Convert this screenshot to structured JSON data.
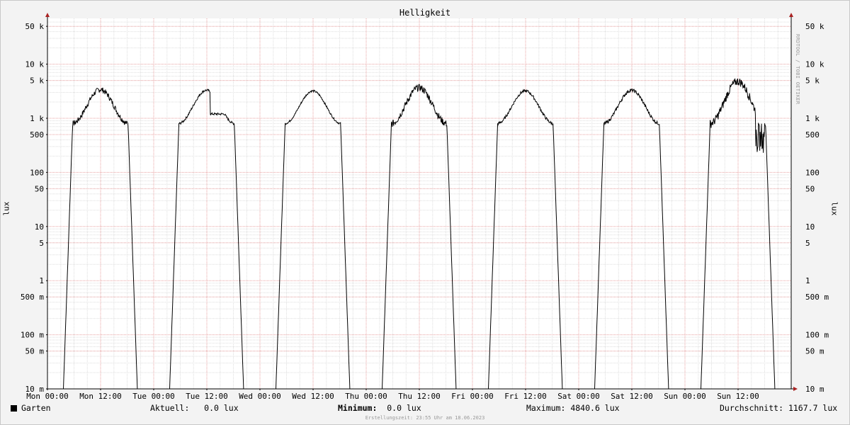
{
  "chart_data": {
    "type": "line",
    "title": "Helligkeit",
    "ylabel": "lux",
    "yscale": "log",
    "ylim": [
      0.01,
      70000
    ],
    "xlim": [
      0,
      168
    ],
    "grid": true,
    "y_ticks": [
      {
        "v": 0.01,
        "label": "10 m"
      },
      {
        "v": 0.05,
        "label": "50 m"
      },
      {
        "v": 0.1,
        "label": "100 m"
      },
      {
        "v": 0.5,
        "label": "500 m"
      },
      {
        "v": 1,
        "label": "1"
      },
      {
        "v": 5,
        "label": "5"
      },
      {
        "v": 10,
        "label": "10"
      },
      {
        "v": 50,
        "label": "50"
      },
      {
        "v": 100,
        "label": "100"
      },
      {
        "v": 500,
        "label": "500"
      },
      {
        "v": 1000,
        "label": "1 k"
      },
      {
        "v": 5000,
        "label": "5 k"
      },
      {
        "v": 10000,
        "label": "10 k"
      },
      {
        "v": 50000,
        "label": "50 k"
      }
    ],
    "x_ticks": [
      {
        "h": 0,
        "label": "Mon 00:00"
      },
      {
        "h": 12,
        "label": "Mon 12:00"
      },
      {
        "h": 24,
        "label": "Tue 00:00"
      },
      {
        "h": 36,
        "label": "Tue 12:00"
      },
      {
        "h": 48,
        "label": "Wed 00:00"
      },
      {
        "h": 60,
        "label": "Wed 12:00"
      },
      {
        "h": 72,
        "label": "Thu 00:00"
      },
      {
        "h": 84,
        "label": "Thu 12:00"
      },
      {
        "h": 96,
        "label": "Fri 00:00"
      },
      {
        "h": 108,
        "label": "Fri 12:00"
      },
      {
        "h": 120,
        "label": "Sat 00:00"
      },
      {
        "h": 132,
        "label": "Sat 12:00"
      },
      {
        "h": 144,
        "label": "Sun 00:00"
      },
      {
        "h": 156,
        "label": "Sun 12:00"
      }
    ],
    "series": [
      {
        "name": "Garten",
        "color": "#000000",
        "days": [
          {
            "day_start_h": 0,
            "peak_lux": 3400,
            "noise": 0.12
          },
          {
            "day_start_h": 24,
            "peak_lux": 3300,
            "noise": 0.05,
            "evening_plateau_lux": 1200
          },
          {
            "day_start_h": 48,
            "peak_lux": 3200,
            "noise": 0.04
          },
          {
            "day_start_h": 72,
            "peak_lux": 3700,
            "noise": 0.15
          },
          {
            "day_start_h": 96,
            "peak_lux": 3200,
            "noise": 0.06
          },
          {
            "day_start_h": 120,
            "peak_lux": 3300,
            "noise": 0.07
          },
          {
            "day_start_h": 144,
            "peak_lux": 4840.6,
            "noise": 0.18,
            "afternoon_dip_lux": 300
          }
        ],
        "sunrise_h": 3.6,
        "sunset_h": 20.3
      }
    ]
  },
  "legend": {
    "series_name": "Garten",
    "current_label": "Aktuell:",
    "current_value": "0.0 lux",
    "min_label": "Minimum:",
    "min_value": "0.0 lux",
    "max_label": "Maximum:",
    "max_value": "4840.6 lux",
    "avg_label": "Durchschnitt:",
    "avg_value": "1167.7 lux"
  },
  "footer": "Erstellungszeit: 23:55 Uhr am 18.06.2023",
  "watermark": "RRDTOOL / TOBI OETIKER",
  "colors": {
    "background": "#f3f3f3",
    "plot_background": "#ffffff",
    "major_grid": "#e8a0a0",
    "minor_grid": "#dedede",
    "arrow": "#aa2222",
    "line": "#000000"
  }
}
